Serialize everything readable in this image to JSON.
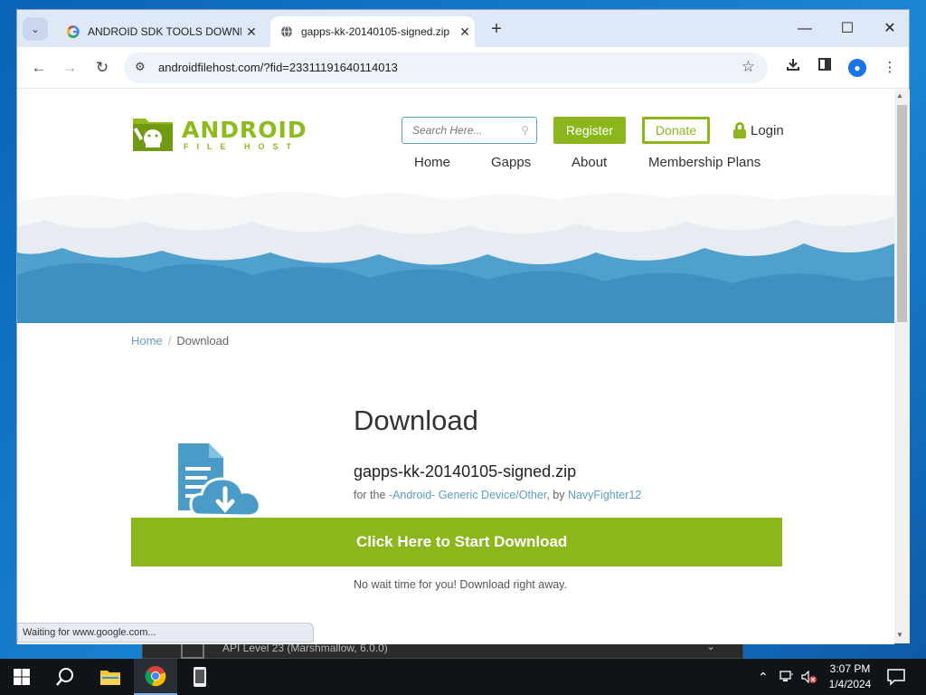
{
  "browser": {
    "tabs": [
      {
        "title": "ANDROID SDK TOOLS DOWNLO",
        "favicon": "google-g-icon"
      },
      {
        "title": "gapps-kk-20140105-signed.zip",
        "favicon": "globe-icon"
      }
    ],
    "url": "androidfilehost.com/?fid=23311191640114013",
    "status_text": "Waiting for www.google.com..."
  },
  "site": {
    "logo_word": "ANDROID",
    "logo_sub": "FILE HOST",
    "search_placeholder": "Search Here...",
    "register_label": "Register",
    "donate_label": "Donate",
    "login_label": "Login",
    "nav": [
      "Home",
      "Gapps",
      "About",
      "Membership Plans"
    ],
    "accent_color": "#8cb71c",
    "link_color": "#5a9ec8"
  },
  "breadcrumb": {
    "home": "Home",
    "sep": "/",
    "current": "Download"
  },
  "download": {
    "heading": "Download",
    "filename": "gapps-kk-20140105-signed.zip",
    "info_prefix": "for the",
    "device_link": "-Android- Generic Device/Other",
    "by_text": ", by",
    "uploader": "NavyFighter12",
    "button_label": "Click Here to Start Download",
    "note": "No wait time for you! Download right away."
  },
  "background_window": {
    "text": "API Level 23 (Marshmallow, 6.0.0)"
  },
  "taskbar": {
    "time": "3:07 PM",
    "date": "1/4/2024"
  }
}
